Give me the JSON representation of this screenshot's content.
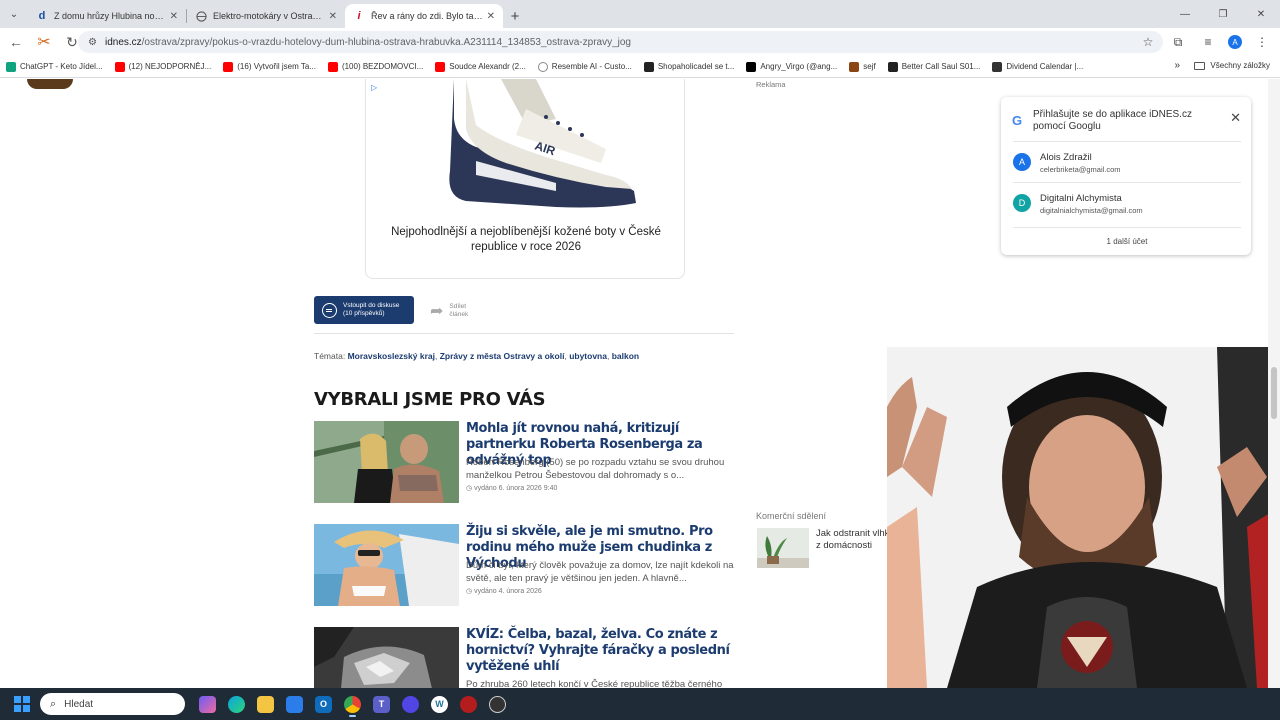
{
  "tabs": [
    {
      "title": "Z domu hrůzy Hlubina nové byty",
      "favicon": "d",
      "active": false
    },
    {
      "title": "Elektro-motokáry v Ostravě | E",
      "favicon": "",
      "active": false
    },
    {
      "title": "Řev a rány do zdi. Bylo tam hou",
      "favicon": "i",
      "active": true
    }
  ],
  "omnibox": {
    "host": "idnes.cz",
    "path": "/ostrava/zpravy/pokus-o-vrazdu-hotelovy-dum-hlubina-ostrava-hrabuvka.A231114_134853_ostrava-zpravy_jog"
  },
  "bookmarks": [
    {
      "label": "ChatGPT - Keto Jídel...",
      "color": "#10a37f"
    },
    {
      "label": "(12) NEJODPORNĚJ...",
      "color": "#ff0000"
    },
    {
      "label": "(16) Vytvořil jsem Ta...",
      "color": "#ff0000"
    },
    {
      "label": "(100) BEZDOMOVCI...",
      "color": "#ff0000"
    },
    {
      "label": "Soudce Alexandr (2...",
      "color": "#ff0000"
    },
    {
      "label": "Resemble AI - Custo...",
      "color": "#888888"
    },
    {
      "label": "Shopaholicadel se t...",
      "color": "#222222"
    },
    {
      "label": "Angry_Virgo (@ang...",
      "color": "#000000"
    },
    {
      "label": "sejf",
      "color": "#8b4513"
    },
    {
      "label": "Better Call Saul S01...",
      "color": "#222222"
    },
    {
      "label": "Dividend Calendar |...",
      "color": "#333333"
    }
  ],
  "bookmarks_folder": "Všechny záložky",
  "ad": {
    "caption": "Nejpohodlnější a nejoblíbenější kožené boty v České republice v roce 2026",
    "reklama": "Reklama"
  },
  "discussion": {
    "line1": "Vstoupit do diskuse",
    "line2": "(10 příspěvků)"
  },
  "share": {
    "line1": "Sdílet",
    "line2": "článek"
  },
  "topics": {
    "label": "Témata:",
    "items": [
      "Moravskoslezský kraj",
      "Zprávy z města Ostravy a okolí",
      "ubytovna",
      "balkon"
    ]
  },
  "section_title": "VYBRALI JSME PRO VÁS",
  "articles": [
    {
      "title": "Mohla jít rovnou nahá, kritizují partnerku Roberta Rosenberga za odvážný top",
      "perex": "Robert Rosenberg (50) se po rozpadu vztahu se svou druhou manželkou Petrou Šebestovou dal dohromady s o...",
      "date": "vydáno 6. února 2026  9:40"
    },
    {
      "title": "Žiju si skvěle, ale je mi smutno. Pro rodinu mého muže jsem chudinka z Východu",
      "perex": "Dům či byt, který člověk považuje za domov, lze najít kdekoli na světě, ale ten pravý je většinou jen jeden. A hlavně...",
      "date": "vydáno 4. února 2026"
    },
    {
      "title": "KVÍZ: Čelba, bazal, želva. Co znáte z hornictví? Vyhrajte fáračky a poslední vytěžené uhlí",
      "perex": "Po zhruba 260 letech končí v České republice těžba černého",
      "date": ""
    }
  ],
  "commercial": {
    "label": "Komerční sdělení",
    "text": "Jak odstranit vlhko z domácnosti"
  },
  "google_popup": {
    "logo": "G",
    "title": "Přihlašujte se do aplikace iDNES.cz pomocí Googlu",
    "accounts": [
      {
        "initial": "A",
        "name": "Alois Zdražil",
        "email": "celerbriketa@gmail.com",
        "color": "#1a73e8"
      },
      {
        "initial": "D",
        "name": "Digitalni Alchymista",
        "email": "digitalnialchymista@gmail.com",
        "color": "#12a4a4"
      }
    ],
    "more": "1 další účet"
  },
  "taskbar": {
    "search_placeholder": "Hledat"
  }
}
